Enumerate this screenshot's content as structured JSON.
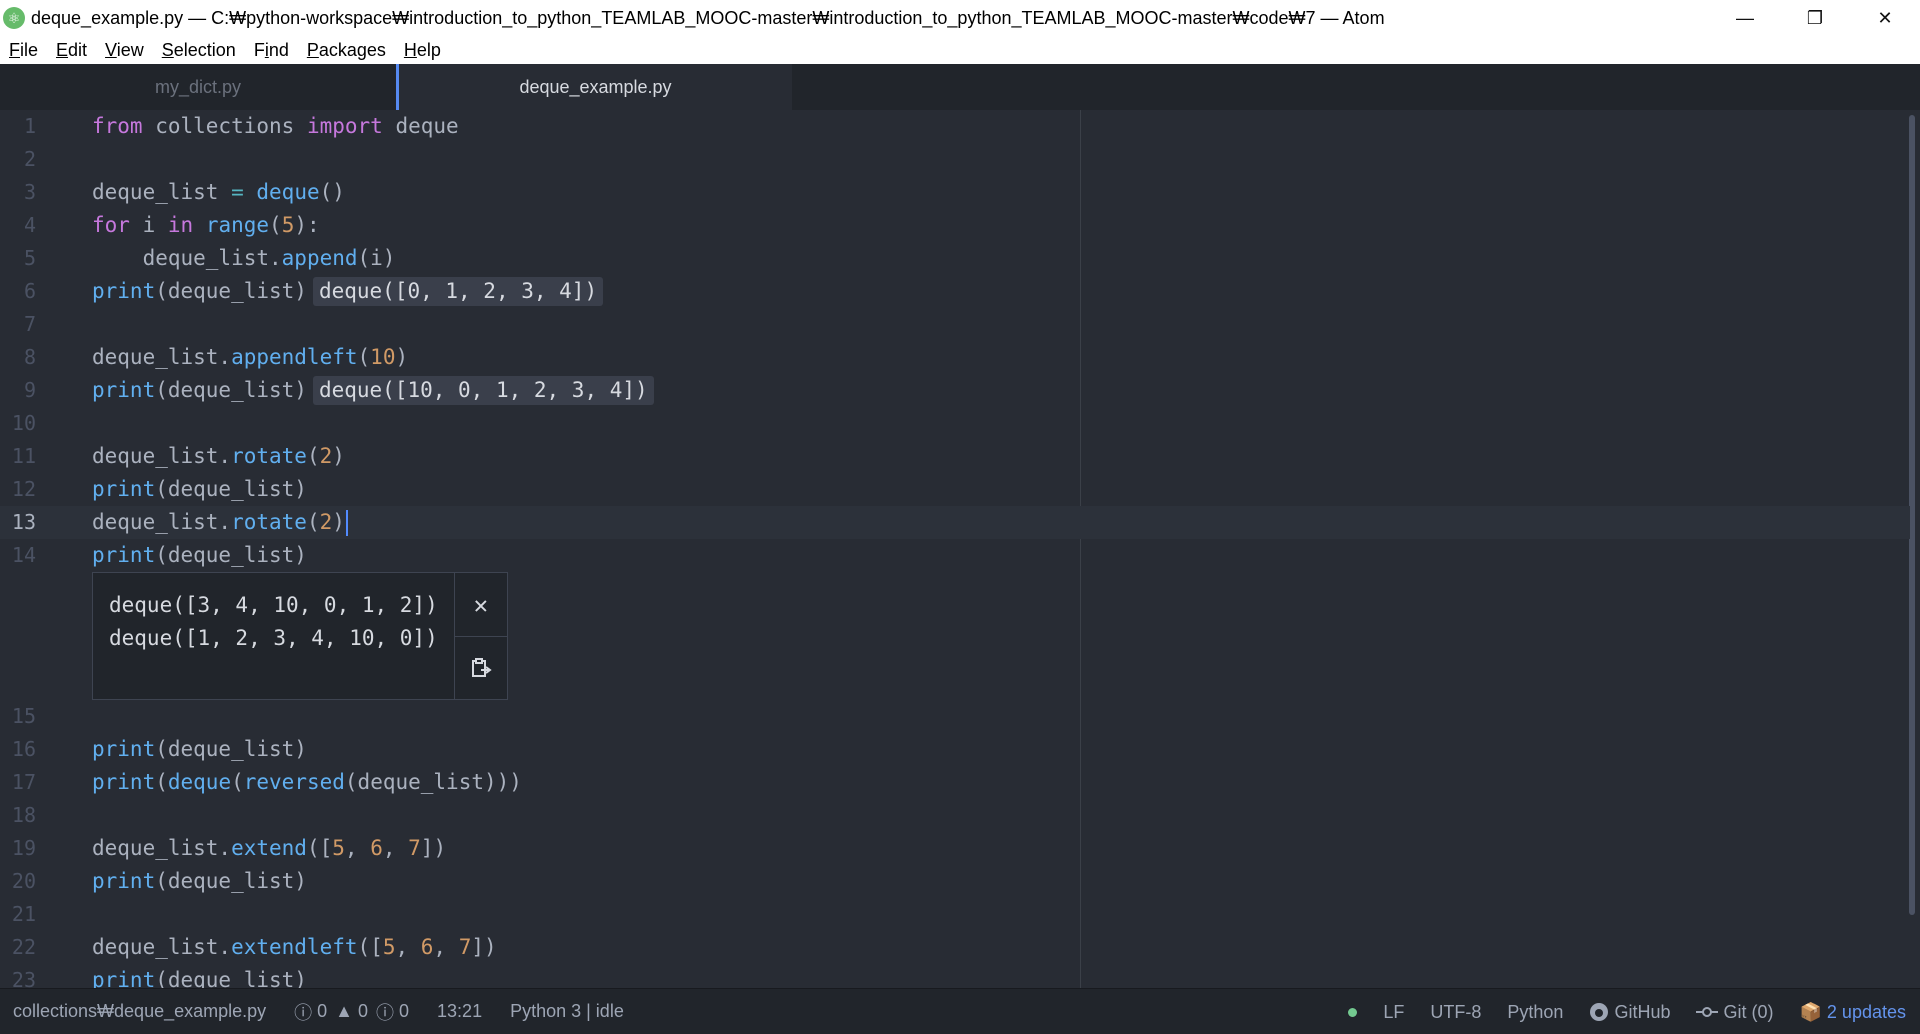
{
  "window": {
    "title": "deque_example.py — C:₩python-workspace₩introduction_to_python_TEAMLAB_MOOC-master₩introduction_to_python_TEAMLAB_MOOC-master₩code₩7 — Atom",
    "app_icon": "atom-icon",
    "controls": {
      "minimize": "—",
      "restore": "❐",
      "close": "✕"
    }
  },
  "menu": [
    {
      "pre": "",
      "acc": "F",
      "post": "ile"
    },
    {
      "pre": "",
      "acc": "E",
      "post": "dit"
    },
    {
      "pre": "",
      "acc": "V",
      "post": "iew"
    },
    {
      "pre": "",
      "acc": "S",
      "post": "election"
    },
    {
      "pre": "F",
      "acc": "i",
      "post": "nd"
    },
    {
      "pre": "",
      "acc": "P",
      "post": "ackages"
    },
    {
      "pre": "",
      "acc": "H",
      "post": "elp"
    }
  ],
  "tabs": [
    {
      "label": "my_dict.py",
      "active": false
    },
    {
      "label": "deque_example.py",
      "active": true
    }
  ],
  "editor": {
    "cursor_line": 13,
    "lines": [
      {
        "n": "1",
        "html": "<span class=\"kw\">from</span> collections <span class=\"kw\">import</span> deque"
      },
      {
        "n": "2",
        "html": ""
      },
      {
        "n": "3",
        "html": "deque_list <span class=\"op\">=</span> <span class=\"fn\">deque</span>()"
      },
      {
        "n": "4",
        "html": "<span class=\"kw\">for</span> i <span class=\"kw\">in</span> <span class=\"fn\">range</span>(<span class=\"num\">5</span>):"
      },
      {
        "n": "5",
        "html": "    deque_list.<span class=\"fn\">append</span>(i)"
      },
      {
        "n": "6",
        "html": "<span class=\"fn\">print</span>(deque_list)",
        "result": "deque([0, 1, 2, 3, 4])"
      },
      {
        "n": "7",
        "html": ""
      },
      {
        "n": "8",
        "html": "deque_list.<span class=\"fn\">appendleft</span>(<span class=\"num\">10</span>)"
      },
      {
        "n": "9",
        "html": "<span class=\"fn\">print</span>(deque_list)",
        "result": "deque([10, 0, 1, 2, 3, 4])"
      },
      {
        "n": "10",
        "html": ""
      },
      {
        "n": "11",
        "html": "deque_list.<span class=\"fn\">rotate</span>(<span class=\"num\">2</span>)"
      },
      {
        "n": "12",
        "html": "<span class=\"fn\">print</span>(deque_list)"
      },
      {
        "n": "13",
        "html": "deque_list.<span class=\"fn\">rotate</span>(<span class=\"num\">2</span>)",
        "caret": true
      },
      {
        "n": "14",
        "html": "<span class=\"fn\">print</span>(deque_list)"
      },
      {
        "n": "15",
        "html": ""
      },
      {
        "n": "16",
        "html": "<span class=\"fn\">print</span>(deque_list)"
      },
      {
        "n": "17",
        "html": "<span class=\"fn\">print</span>(<span class=\"fn\">deque</span>(<span class=\"fn\">reversed</span>(deque_list)))"
      },
      {
        "n": "18",
        "html": ""
      },
      {
        "n": "19",
        "html": "deque_list.<span class=\"fn\">extend</span>([<span class=\"num\">5</span>, <span class=\"num\">6</span>, <span class=\"num\">7</span>])"
      },
      {
        "n": "20",
        "html": "<span class=\"fn\">print</span>(deque_list)"
      },
      {
        "n": "21",
        "html": ""
      },
      {
        "n": "22",
        "html": "deque_list.<span class=\"fn\">extendleft</span>([<span class=\"num\">5</span>, <span class=\"num\">6</span>, <span class=\"num\">7</span>])"
      },
      {
        "n": "23",
        "html": "<span class=\"fn\">print</span>(deque_list)"
      }
    ]
  },
  "output_popup": {
    "lines": [
      "deque([3, 4, 10, 0, 1, 2])",
      "deque([1, 2, 3, 4, 10, 0])"
    ],
    "close_icon": "close-icon",
    "copy_icon": "clipboard-icon"
  },
  "status": {
    "file_path": "collections₩deque_example.py",
    "linter": {
      "errors": "0",
      "warnings": "0",
      "info": "0"
    },
    "cursor_position": "13:21",
    "kernel": "Python 3 | idle",
    "line_ending": "LF",
    "encoding": "UTF-8",
    "grammar": "Python",
    "github": "GitHub",
    "git": "Git (0)",
    "updates": "2 updates"
  },
  "colors": {
    "editor_bg": "#282c34",
    "accent": "#568af2",
    "keyword": "#c678dd",
    "function": "#61afef",
    "number": "#d19a66"
  }
}
